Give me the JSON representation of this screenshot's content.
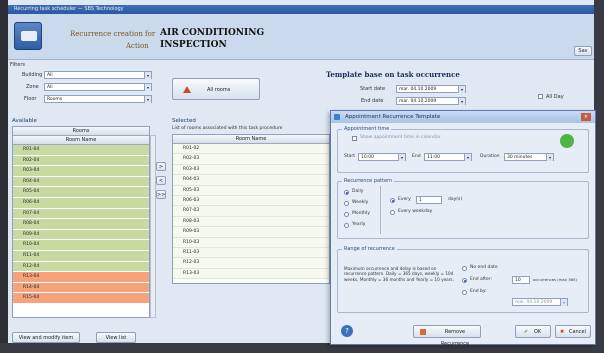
{
  "window": {
    "title": "Recurring task scheduler — SBS Technology"
  },
  "header": {
    "recurrence_label": "Recurrence creation for",
    "recurrence_value": "AIR CONDITIONING",
    "action_label": "Action",
    "action_value": "INSPECTION",
    "right_button": "Sav"
  },
  "filters": {
    "title": "Filters",
    "building_label": "Building",
    "building_value": "All",
    "zone_label": "Zone",
    "zone_value": "All",
    "floor_label": "Floor",
    "floor_value": "Rooms"
  },
  "all_rooms_button": "All rooms",
  "available": {
    "title": "Available",
    "group_header": "Rooms",
    "column_header": "Room Name",
    "rows": [
      {
        "name": "R01-04",
        "color": "green"
      },
      {
        "name": "R02-04",
        "color": "green"
      },
      {
        "name": "R03-04",
        "color": "green"
      },
      {
        "name": "R04-04",
        "color": "green"
      },
      {
        "name": "R05-04",
        "color": "green"
      },
      {
        "name": "R06-04",
        "color": "green"
      },
      {
        "name": "R07-04",
        "color": "green"
      },
      {
        "name": "R08-04",
        "color": "green"
      },
      {
        "name": "R09-04",
        "color": "green"
      },
      {
        "name": "R10-04",
        "color": "green"
      },
      {
        "name": "R11-04",
        "color": "green"
      },
      {
        "name": "R12-04",
        "color": "green"
      },
      {
        "name": "R13-04",
        "color": "orange"
      },
      {
        "name": "R14-04",
        "color": "orange"
      },
      {
        "name": "R15-04",
        "color": "orange"
      }
    ],
    "footer_button_1": "View and modify item",
    "footer_button_2": "View list"
  },
  "move_buttons": [
    ">",
    "<",
    ">>"
  ],
  "selected": {
    "title": "Selected",
    "note": "List of rooms associated with this task procedure",
    "column_header": "Room Name",
    "rows": [
      "R01-02",
      "R02-03",
      "R03-03",
      "R04-03",
      "R05-03",
      "R06-03",
      "R07-03",
      "R08-03",
      "R09-03",
      "R10-03",
      "R11-03",
      "R12-03",
      "R13-03"
    ]
  },
  "template": {
    "title": "Template base on task occurrence",
    "start_label": "Start date",
    "start_value": "mar. 04.10.2009",
    "end_label": "End date",
    "end_value": "mar. 04.10.2009",
    "allday_label": "All Day"
  },
  "dialog": {
    "title": "Appointment Recurrence Template",
    "time": {
      "title": "Appointment time",
      "use_time_label": "Show appointment time in calendar",
      "start_label": "Start",
      "start_value": "10:00",
      "end_label": "End",
      "end_value": "11:00",
      "duration_label": "Duration",
      "duration_value": "30 minutes"
    },
    "pattern": {
      "title": "Recurrence pattern",
      "options": [
        "Daily",
        "Weekly",
        "Monthly",
        "Yearly"
      ],
      "every_label": "Every",
      "every_value": "1",
      "every_unit": "day(s)",
      "weekday_label": "Every weekday"
    },
    "range": {
      "title": "Range of recurrence",
      "note": "Maximum occurrence and delay is based on recurrence pattern. Daily = 365 days, weekly = 104 weeks, Monthly = 36 months and Yearly = 10 years.",
      "no_end": "No end date",
      "end_after": "End after:",
      "end_after_value": "10",
      "end_after_unit": "occurrences (max 365)",
      "end_by": "End by:",
      "end_by_value": "mar. 04.10.2009"
    },
    "remove_button": "Remove Recurrence",
    "ok_button": "OK",
    "cancel_button": "Cancel"
  }
}
